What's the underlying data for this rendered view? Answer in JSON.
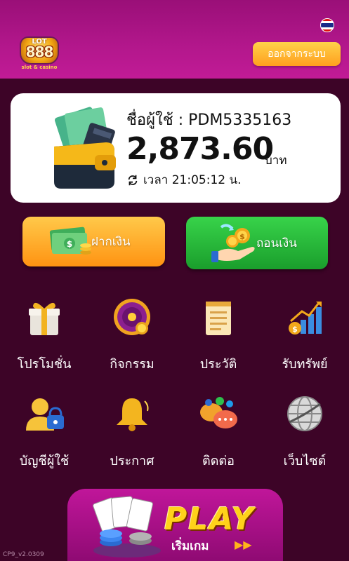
{
  "header": {
    "logo_top": "LOT",
    "logo_main": "888",
    "logo_sub": "slot & casino",
    "logout_label": "ออกจากระบบ",
    "flag": "thailand-flag"
  },
  "account": {
    "username_label": "ชื่อผู้ใช้ : PDM5335163",
    "balance": "2,873.60",
    "currency": "บาท",
    "time_label": "เวลา 21:05:12 น."
  },
  "actions": {
    "deposit_label": "ฝากเงิน",
    "withdraw_label": "ถอนเงิน"
  },
  "menu": [
    {
      "label": "โปรโมชั่น",
      "icon": "gift-icon"
    },
    {
      "label": "กิจกรรม",
      "icon": "wheel-icon"
    },
    {
      "label": "ประวัติ",
      "icon": "history-note-icon"
    },
    {
      "label": "รับทรัพย์",
      "icon": "growth-chart-icon"
    },
    {
      "label": "บัญชีผู้ใช้",
      "icon": "user-lock-icon"
    },
    {
      "label": "ประกาศ",
      "icon": "bell-icon"
    },
    {
      "label": "ติดต่อ",
      "icon": "chat-icon"
    },
    {
      "label": "เว็บไซต์",
      "icon": "globe-icon"
    }
  ],
  "play": {
    "title": "PLAY",
    "subtitle": "เริ่มเกม",
    "arrows": "▶▶"
  },
  "version": "CP9_v2.0309",
  "colors": {
    "background": "#3d0427",
    "header": "#b3178c",
    "logout": "#ffb12c",
    "deposit": "#ffb02e",
    "withdraw": "#2bbf3d"
  }
}
